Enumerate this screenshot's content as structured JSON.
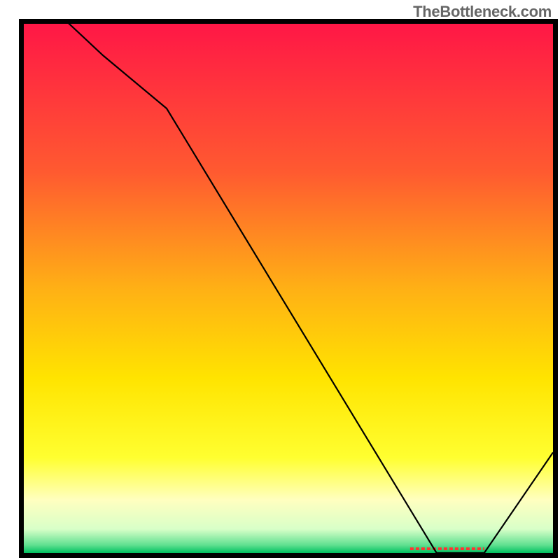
{
  "attribution": "TheBottleneck.com",
  "chart_data": {
    "type": "line",
    "title": "",
    "xlabel": "",
    "ylabel": "",
    "xlim": [
      0,
      100
    ],
    "ylim": [
      0,
      100
    ],
    "x": [
      0,
      15,
      27,
      78,
      87,
      100
    ],
    "values": [
      108,
      94,
      84,
      0,
      0,
      19
    ],
    "marker_range_x": [
      73,
      87
    ],
    "gradient_stops": [
      {
        "offset": 0,
        "color": "#ff1746"
      },
      {
        "offset": 0.28,
        "color": "#ff5a30"
      },
      {
        "offset": 0.5,
        "color": "#ffb015"
      },
      {
        "offset": 0.67,
        "color": "#ffe400"
      },
      {
        "offset": 0.82,
        "color": "#ffff30"
      },
      {
        "offset": 0.9,
        "color": "#ffffc0"
      },
      {
        "offset": 0.955,
        "color": "#d8ffc8"
      },
      {
        "offset": 0.985,
        "color": "#60e090"
      },
      {
        "offset": 1.0,
        "color": "#00c060"
      }
    ],
    "axis_color": "#000000",
    "line_color": "#000000",
    "marker_color": "#ff3333"
  }
}
